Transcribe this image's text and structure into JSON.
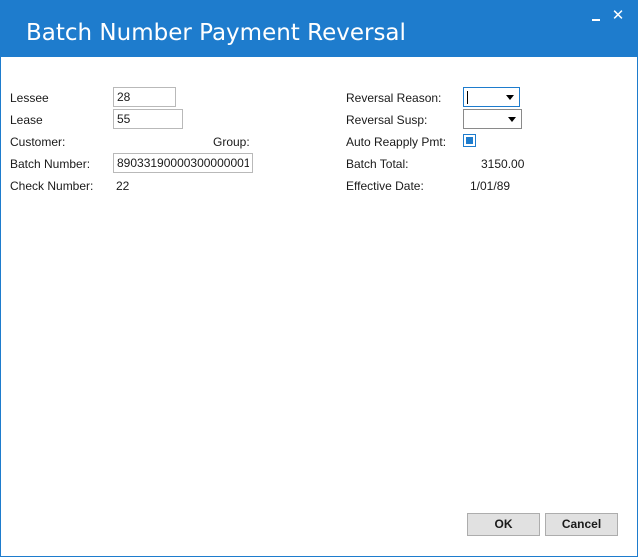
{
  "window": {
    "title": "Batch Number Payment Reversal",
    "minimize_label": "_",
    "close_label": "✕"
  },
  "left": {
    "lessee_label": "Lessee",
    "lessee_value": "28",
    "lease_label": "Lease",
    "lease_value": "55",
    "customer_label": "Customer:",
    "group_label": "Group:",
    "batch_number_label": "Batch Number:",
    "batch_number_value": "89033190000300000001",
    "check_number_label": "Check Number:",
    "check_number_value": "22"
  },
  "right": {
    "reversal_reason_label": "Reversal Reason:",
    "reversal_reason_value": "",
    "reversal_susp_label": "Reversal Susp:",
    "reversal_susp_value": "",
    "auto_reapply_label": "Auto Reapply Pmt:",
    "auto_reapply_checked": true,
    "batch_total_label": "Batch Total:",
    "batch_total_value": "3150.00",
    "effective_date_label": "Effective Date:",
    "effective_date_value": "1/01/89"
  },
  "buttons": {
    "ok_label": "OK",
    "cancel_label": "Cancel"
  },
  "colors": {
    "accent": "#1e7ccd",
    "title_text": "#ffffff",
    "button_face": "#e1e1e1"
  }
}
